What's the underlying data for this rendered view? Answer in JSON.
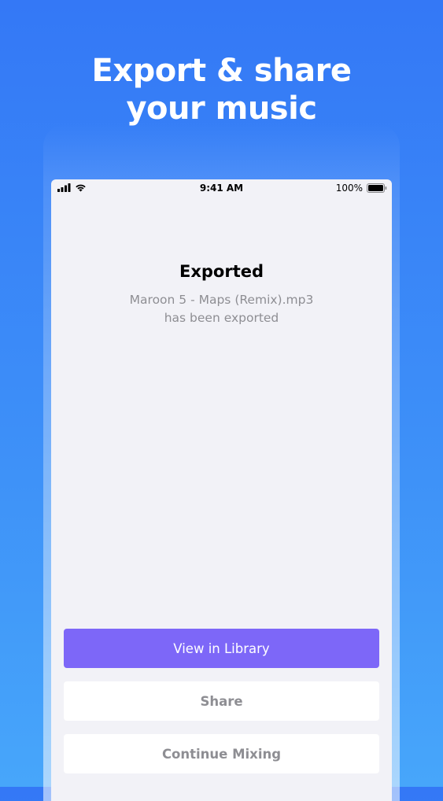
{
  "headline": {
    "line1": "Export & share",
    "line2": "your music"
  },
  "status_bar": {
    "time": "9:41 AM",
    "battery_percent": "100%",
    "icons": [
      "signal-icon",
      "wifi-icon",
      "battery-icon"
    ]
  },
  "export": {
    "title": "Exported",
    "filename": "Maroon 5 - Maps (Remix).mp3",
    "message": "has been exported"
  },
  "buttons": {
    "view_library": "View in Library",
    "share": "Share",
    "continue_mixing": "Continue Mixing"
  },
  "colors": {
    "background_top": "#3478f6",
    "background_bottom": "#47a6fa",
    "primary_button": "#7d67f8",
    "screen_background": "#f2f2f7",
    "secondary_text": "#8e8e93"
  }
}
